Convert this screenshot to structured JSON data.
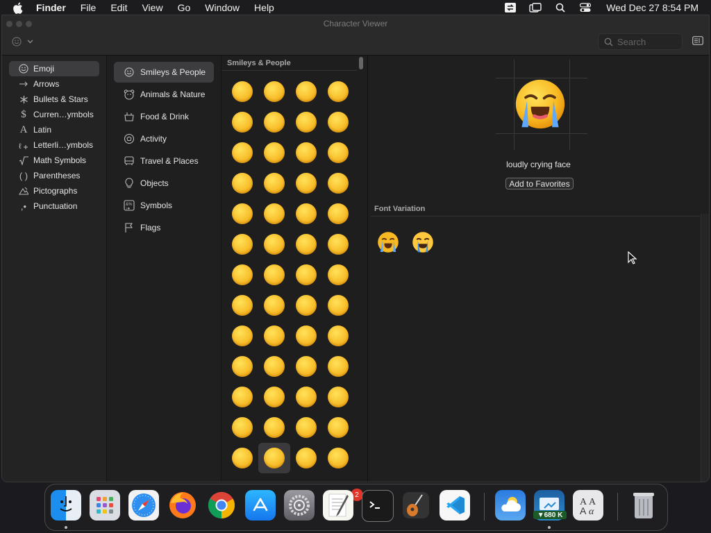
{
  "menubar": {
    "app_name": "Finder",
    "items": [
      "File",
      "Edit",
      "View",
      "Go",
      "Window",
      "Help"
    ],
    "datetime": "Wed Dec 27  8:54 PM"
  },
  "window": {
    "title": "Character Viewer",
    "search_placeholder": "Search"
  },
  "categories": [
    {
      "label": "Emoji",
      "icon": "smiley-icon",
      "selected": true
    },
    {
      "label": "Arrows",
      "icon": "arrow-right-icon"
    },
    {
      "label": "Bullets & Stars",
      "icon": "asterisk-icon"
    },
    {
      "label": "Curren…ymbols",
      "icon": "dollar-icon"
    },
    {
      "label": "Latin",
      "icon": "latin-letter-icon"
    },
    {
      "label": "Letterli…ymbols",
      "icon": "letterlike-icon"
    },
    {
      "label": "Math Symbols",
      "icon": "square-root-icon"
    },
    {
      "label": "Parentheses",
      "icon": "parentheses-icon"
    },
    {
      "label": "Pictographs",
      "icon": "pictograph-icon"
    },
    {
      "label": "Punctuation",
      "icon": "punctuation-icon"
    }
  ],
  "subcategories": [
    {
      "label": "Smileys & People",
      "icon": "smiley-icon",
      "selected": true
    },
    {
      "label": "Animals & Nature",
      "icon": "bear-icon"
    },
    {
      "label": "Food & Drink",
      "icon": "food-icon"
    },
    {
      "label": "Activity",
      "icon": "soccer-ball-icon"
    },
    {
      "label": "Travel & Places",
      "icon": "car-icon"
    },
    {
      "label": "Objects",
      "icon": "lightbulb-icon"
    },
    {
      "label": "Symbols",
      "icon": "symbols-icon"
    },
    {
      "label": "Flags",
      "icon": "flag-icon"
    }
  ],
  "emoji_section": {
    "title": "Smileys & People",
    "emojis": [
      "😀",
      "😃",
      "😄",
      "😁",
      "😆",
      "🥹",
      "😅",
      "😂",
      "🤣",
      "🥲",
      "☺️",
      "😊",
      "😇",
      "🙂",
      "🙃",
      "😉",
      "😌",
      "😍",
      "🥰",
      "😘",
      "😗",
      "😙",
      "😚",
      "😋",
      "😛",
      "😝",
      "😜",
      "🤪",
      "🤨",
      "🧐",
      "🤓",
      "😎",
      "🥸",
      "🤩",
      "🥳",
      "😏",
      "😒",
      "😞",
      "😔",
      "😟",
      "😕",
      "🙁",
      "☹️",
      "😣",
      "😖",
      "😫",
      "😩",
      "🥺",
      "😢",
      "😭",
      "😤",
      "😠"
    ],
    "selected_index": 49
  },
  "detail": {
    "emoji": "😭",
    "name": "loudly crying face",
    "favorites_button": "Add to Favorites",
    "font_variation_title": "Font Variation",
    "variations": [
      "😭",
      "😭"
    ]
  },
  "dock": {
    "apps": [
      "Finder",
      "Launchpad",
      "Safari",
      "Firefox",
      "Chrome",
      "App Store",
      "System Settings",
      "TextEdit",
      "Terminal",
      "GarageBand",
      "Visual Studio Code",
      "Weather",
      "Network Monitor",
      "Font Book",
      "Trash"
    ],
    "settings_badge": "2",
    "network_rate": "▼680 K"
  },
  "colors": {
    "accent_selected": "#3d3d3f",
    "emoji_yellow": "#f7b823"
  }
}
